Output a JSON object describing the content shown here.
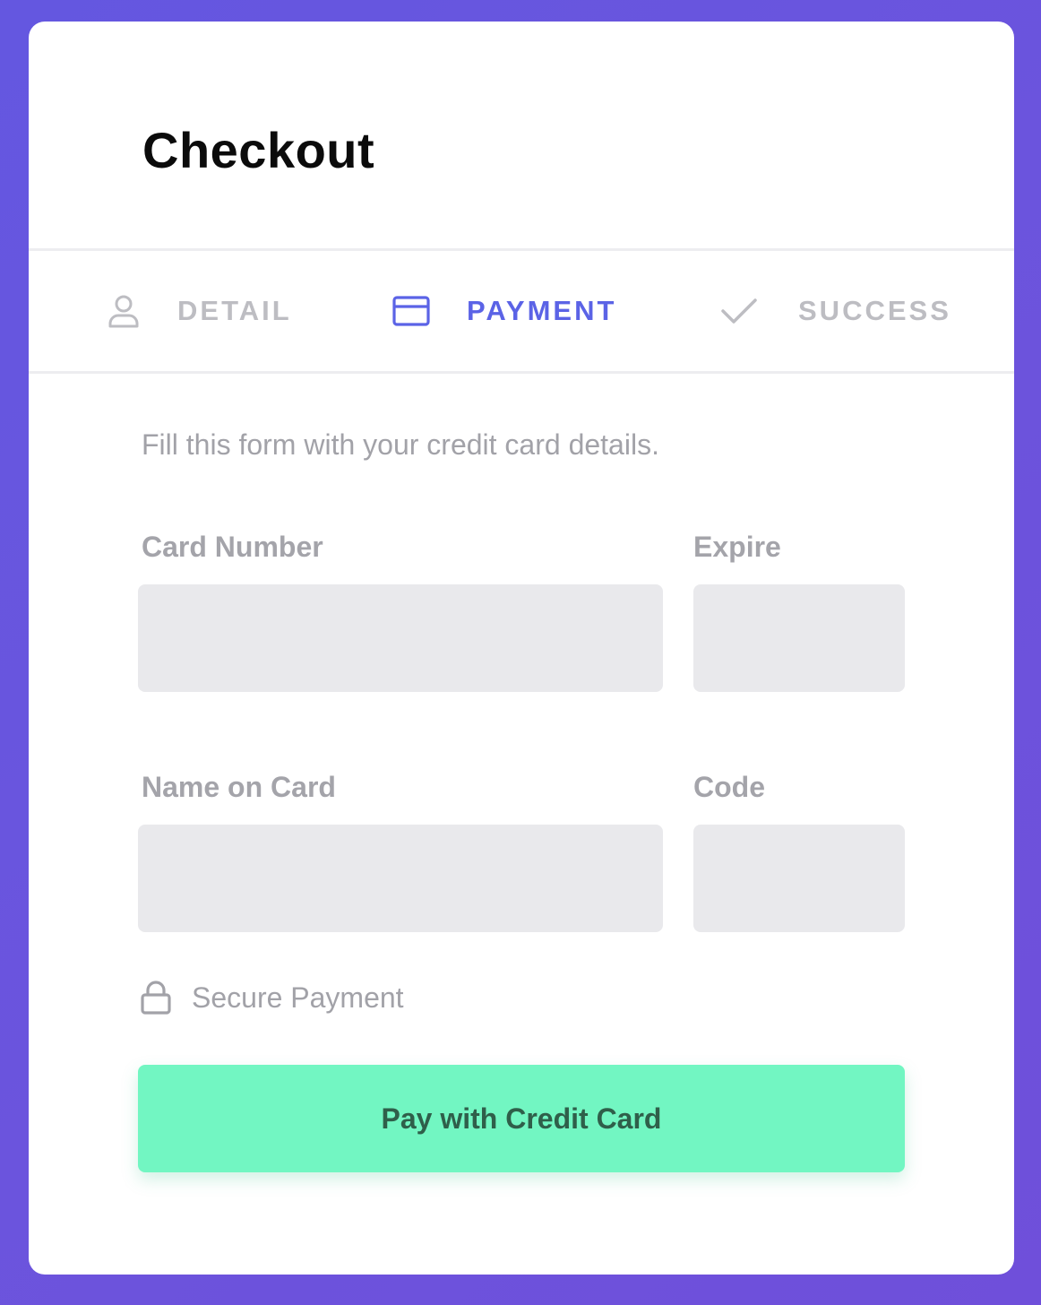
{
  "header": {
    "title": "Checkout"
  },
  "steps": [
    {
      "label": "DETAIL",
      "icon": "user-icon",
      "state": "inactive"
    },
    {
      "label": "PAYMENT",
      "icon": "credit-card-icon",
      "state": "active"
    },
    {
      "label": "SUCCESS",
      "icon": "check-icon",
      "state": "inactive"
    }
  ],
  "form": {
    "intro": "Fill this form with your credit card details.",
    "card_number": {
      "label": "Card Number",
      "value": "",
      "placeholder": ""
    },
    "expire": {
      "label": "Expire",
      "value": "",
      "placeholder": ""
    },
    "name_on_card": {
      "label": "Name on Card",
      "value": "",
      "placeholder": ""
    },
    "code": {
      "label": "Code",
      "value": "",
      "placeholder": ""
    },
    "secure_note": {
      "text": "Secure Payment",
      "icon": "lock-icon"
    },
    "submit_label": "Pay with Credit Card"
  },
  "colors": {
    "background": "#6a55de",
    "accent": "#5b63e6",
    "inactive_step": "#bdbdc2",
    "button": "#72f6c2",
    "button_text": "#2f5f4a",
    "input_bg": "#e9e9ec"
  }
}
